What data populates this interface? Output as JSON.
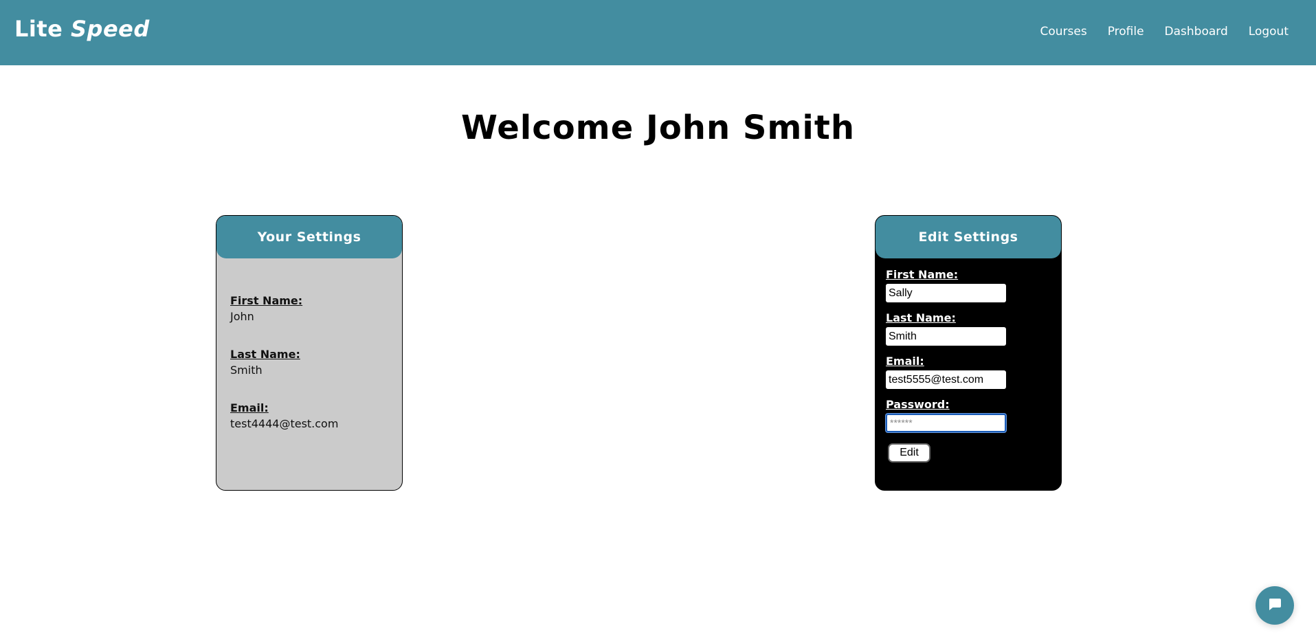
{
  "navbar": {
    "brand": {
      "part1": "Lite",
      "part2": "Speed"
    },
    "links": [
      {
        "label": "Courses"
      },
      {
        "label": "Profile"
      },
      {
        "label": "Dashboard"
      },
      {
        "label": "Logout"
      }
    ]
  },
  "page": {
    "title": "Welcome John Smith"
  },
  "your_settings": {
    "title": "Your Settings",
    "fields": [
      {
        "label": "First Name:",
        "value": "John"
      },
      {
        "label": "Last Name:",
        "value": "Smith"
      },
      {
        "label": "Email:",
        "value": "test4444@test.com"
      }
    ]
  },
  "edit_settings": {
    "title": "Edit Settings",
    "first_name": {
      "label": "First Name:",
      "value": "Sally"
    },
    "last_name": {
      "label": "Last Name:",
      "value": "Smith"
    },
    "email": {
      "label": "Email:",
      "value": "test5555@test.com"
    },
    "password": {
      "label": "Password:",
      "placeholder": "******"
    },
    "submit_label": "Edit"
  },
  "chat": {
    "icon": "chat-bubble-icon"
  },
  "colors": {
    "brand": "#438da0",
    "card_left_bg": "#cbcbcb",
    "card_right_bg": "#000000"
  }
}
